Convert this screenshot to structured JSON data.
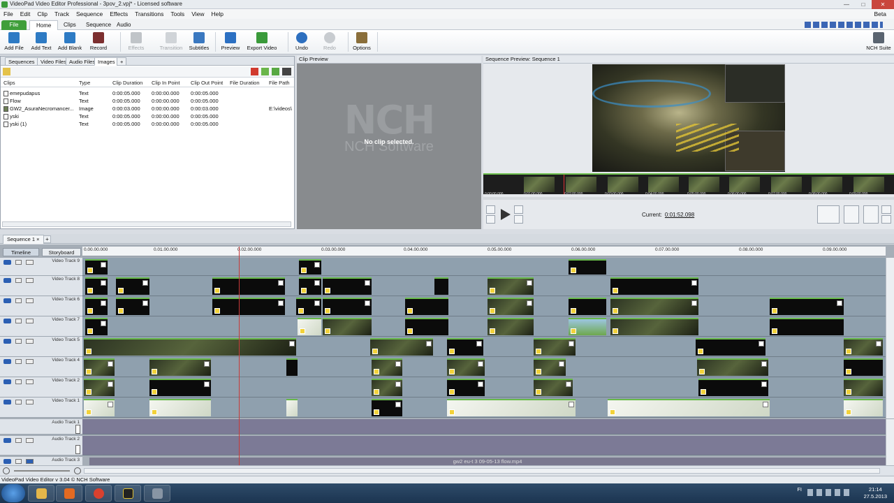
{
  "window": {
    "title": "VideoPad Video Editor Professional - 3pov_2.vpj* - Licensed software"
  },
  "menu": {
    "items": [
      "File",
      "Edit",
      "Clip",
      "Track",
      "Sequence",
      "Effects",
      "Transitions",
      "Tools",
      "View",
      "Help"
    ],
    "beta": "Beta"
  },
  "ribbon": {
    "tabs": [
      "File",
      "Home",
      "Clips",
      "Sequence",
      "Audio"
    ],
    "buttons": {
      "add_file": "Add File",
      "add_text": "Add Text",
      "add_blank": "Add Blank",
      "record": "Record",
      "effects": "Effects",
      "transition": "Transition",
      "subtitles": "Subtitles",
      "preview": "Preview",
      "export_video": "Export Video",
      "undo": "Undo",
      "redo": "Redo",
      "options": "Options",
      "nch_suite": "NCH Suite"
    }
  },
  "bins": {
    "tabs": [
      "Sequences",
      "Video Files",
      "Audio Files",
      "Images"
    ],
    "columns": [
      "Clips",
      "Type",
      "Clip Duration",
      "Clip In Point",
      "Clip Out Point",
      "File Duration",
      "File Path"
    ],
    "rows": [
      {
        "name": "emepudapus",
        "type": "Text",
        "duration": "0:00:05.000",
        "in": "0:00:00.000",
        "out": "0:00:05.000",
        "file_duration": "",
        "path": ""
      },
      {
        "name": "Flow",
        "type": "Text",
        "duration": "0:00:05.000",
        "in": "0:00:00.000",
        "out": "0:00:05.000",
        "file_duration": "",
        "path": ""
      },
      {
        "name": "GW2_AsuraNecromancer...",
        "type": "Image",
        "duration": "0:00:03.000",
        "in": "0:00:00.000",
        "out": "0:00:03.000",
        "file_duration": "",
        "path": "E:\\videos\\"
      },
      {
        "name": "yski",
        "type": "Text",
        "duration": "0:00:05.000",
        "in": "0:00:00.000",
        "out": "0:00:05.000",
        "file_duration": "",
        "path": ""
      },
      {
        "name": "yski (1)",
        "type": "Text",
        "duration": "0:00:05.000",
        "in": "0:00:00.000",
        "out": "0:00:05.000",
        "file_duration": "",
        "path": ""
      }
    ]
  },
  "clip_preview": {
    "header": "Clip Preview",
    "message": "No clip selected.",
    "logo_big": "NCH",
    "logo_small": "NCH Software"
  },
  "sequence_preview": {
    "header": "Sequence Preview: Sequence 1",
    "current_label": "Current:",
    "current_time": "0:01:52.098",
    "strip_ticks": [
      "0:00:00.000",
      "0:01:00.000",
      "0:02:00.000",
      "0:03:00.000",
      "0:04:00.000",
      "0:05:00.000",
      "0:06:00.000",
      "0:07:00.000",
      "0:08:00.000",
      "0:09:00.000"
    ]
  },
  "sequence_tab": "Sequence 1",
  "timeline": {
    "view_buttons": [
      "Timeline",
      "Storyboard"
    ],
    "ruler": [
      "0.00.00.000",
      "0.01.00.000",
      "0.02.00.000",
      "0.03.00.000",
      "0.04.00.000",
      "0.05.00.000",
      "0.06.00.000",
      "0.07.00.000",
      "0.08.00.000",
      "0.09.00.000"
    ],
    "tracks": [
      "Video Track 9",
      "Video Track 8",
      "Video Track 6",
      "Video Track 7",
      "Video Track 5",
      "Video Track 4",
      "Video Track 2",
      "Video Track 1"
    ],
    "audio_tracks": [
      "Audio Track 1",
      "Audio Track 2",
      "Audio Track 3"
    ],
    "audio_file": "gw2 eu-t 3 09-05-13 flow.mp4"
  },
  "status": "VideoPad Video Editor v 3.04 © NCH Software",
  "taskbar": {
    "lang": "FI",
    "time": "21:14",
    "date": "27.5.2013"
  }
}
